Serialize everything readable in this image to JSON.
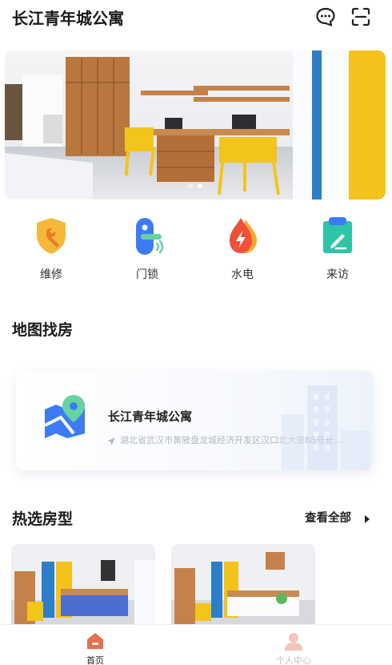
{
  "header": {
    "title": "长江青年城公寓",
    "chat_icon": "chat-bubble-icon",
    "scan_icon": "scan-icon"
  },
  "banner": {
    "slide_count": 2,
    "active_slide": 2
  },
  "shortcuts": [
    {
      "label": "维修",
      "icon": "repair-shield-icon",
      "color": "#F5B83A"
    },
    {
      "label": "门锁",
      "icon": "door-lock-icon",
      "color": "#3D7BF5"
    },
    {
      "label": "水电",
      "icon": "water-electric-icon",
      "color": "#F0503A"
    },
    {
      "label": "来访",
      "icon": "visitor-register-icon",
      "color": "#2EC4A8"
    }
  ],
  "map_section": {
    "title": "地图找房",
    "apartment_name": "长江青年城公寓",
    "address": "湖北省武汉市黄陂盘龙城经济开发区汉口北大道88号长..."
  },
  "rooms_section": {
    "title": "热选房型",
    "view_all": "查看全部"
  },
  "tabbar": {
    "items": [
      {
        "label": "首页",
        "icon": "home-icon",
        "active": true
      },
      {
        "label": "个人中心",
        "icon": "person-icon",
        "active": false
      }
    ],
    "accent": "#E8704F"
  }
}
